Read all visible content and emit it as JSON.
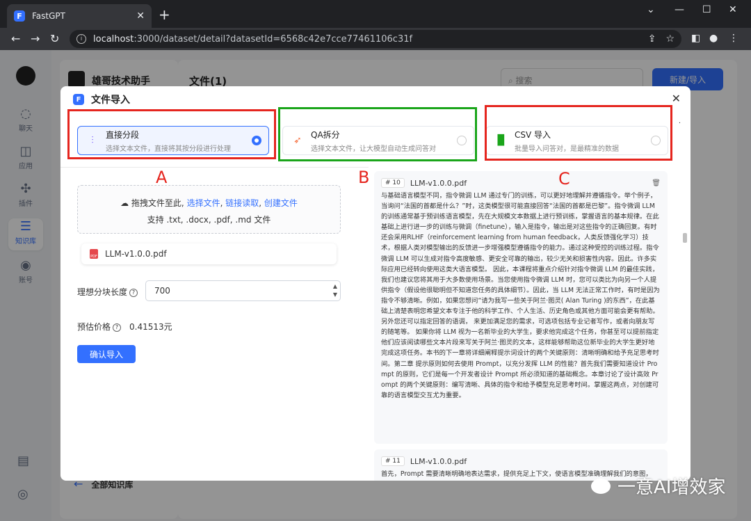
{
  "browser": {
    "tab_title": "FastGPT",
    "url_host": "localhost",
    "url_rest": ":3000/dataset/detail?datasetId=6568c42e7cce77461106c31f"
  },
  "sidebar": {
    "items": [
      {
        "label": "聊天",
        "icon": "chat-icon"
      },
      {
        "label": "应用",
        "icon": "robot-icon"
      },
      {
        "label": "插件",
        "icon": "puzzle-icon"
      },
      {
        "label": "知识库",
        "icon": "database-icon"
      },
      {
        "label": "账号",
        "icon": "user-icon"
      }
    ]
  },
  "dataset": {
    "name": "雄哥技术助手",
    "back_label": "全部知识库"
  },
  "main": {
    "title": "文件(1)",
    "search_placeholder": "搜索",
    "import_button": "新建/导入"
  },
  "modal": {
    "title": "文件导入",
    "modes": [
      {
        "title": "直接分段",
        "desc": "选择文本文件，直接将其按分段进行处理",
        "selected": true
      },
      {
        "title": "QA拆分",
        "desc": "选择文本文件，让大模型自动生成问答对",
        "selected": false
      },
      {
        "title": "CSV 导入",
        "desc": "批量导入问答对，是最精准的数据",
        "selected": false
      }
    ],
    "annotation_letters": [
      "A",
      "B",
      "C"
    ],
    "annotation_colors": {
      "a": "#e5251e",
      "b": "#1aa51a",
      "c": "#e5251e"
    },
    "dropzone": {
      "prefix": "拖拽文件至此,",
      "link_select": "选择文件",
      "link_url": "链接读取",
      "link_create": "创建文件",
      "types": "支持 .txt, .docx, .pdf, .md 文件"
    },
    "file_name": "LLM-v1.0.0.pdf",
    "chunk_label": "理想分块长度",
    "chunk_value": "700",
    "price_label": "预估价格",
    "price_value": "0.41513元",
    "confirm_button": "确认导入"
  },
  "preview": {
    "chunks": [
      {
        "index": "# 10",
        "file": "LLM-v1.0.0.pdf",
        "text": "与基础语言模型不同，指令微调 LLM 通过专门的训练，可以更好地理解并遵循指令。举个例子，当询问“法国的首都是什么？”时，这类模型很可能直接回答“法国的首都是巴黎”。指令微调 LLM 的训练通常基于预训练语言模型，先在大规模文本数据上进行预训练，掌握语言的基本规律。在此基础上进行进一步的训练与微调（finetune），输入是指令，输出是对这些指令的正确回复。有时还会采用RLHF（reinforcement learning from human feedback，人类反馈强化学习）技术，根据人类对模型输出的反馈进一步增强模型遵循指令的能力。通过这种受控的训练过程。指令微调 LLM 可以生成对指令高度敏感、更安全可靠的输出，较少无关和损害性内容。因此。许多实际应用已经转向使用这类大语言模型。\n因此，本课程将重点介绍针对指令微调 LLM 的最佳实践，我们也建议您将其用于大多数使用场景。当您使用指令微调 LLM 时，您可以类比为向另一个人提供指令（假设他很聪明但不知道您任务的具体细节）。因此，当 LLM 无法正常工作时，有时是因为指令不够清晰。例如，如果您想问“请为我写一些关于阿兰·图灵( Alan Turing )的东西”，在此基础上清楚表明您希望文本专注于他的科学工作、个人生活、历史角色或其他方面可能会更有帮助。另外您还可以指定回答的语调， 来更加满足您的需求，可选项包括专业记者写作，或者向朋友写的随笔等。\n如果你将 LLM 视为一名新毕业的大学生，要求他完成这个任务，你甚至可以提前指定他们应该阅读哪些文本片段来写关于阿兰·图灵的文本，这样能够帮助这位新毕业的大学生更好地完成这项任务。本书的下一章将详细阐释提示词设计的两个关键原则：清晰明确和给予充足思考时间。第二章 提示原则如何去使用 Prompt，以充分发挥 LLM 的性能？首先我们需要知道设计 Prompt 的原则，它们是每一个开发者设计 Prompt 所必须知道的基础概念。本章讨论了设计高效 Prompt 的两个关键原则：编写清晰、具体的指令和给予模型充足思考时间。掌握这两点，对创建可靠的语言模型交互尤为重要。"
      },
      {
        "index": "# 11",
        "file": "LLM-v1.0.0.pdf",
        "text": "首先，Prompt 需要清晰明确地表达需求，提供充足上下文，使语言模型准确理解我们的意图，"
      }
    ]
  },
  "watermark": "一意AI增效家"
}
